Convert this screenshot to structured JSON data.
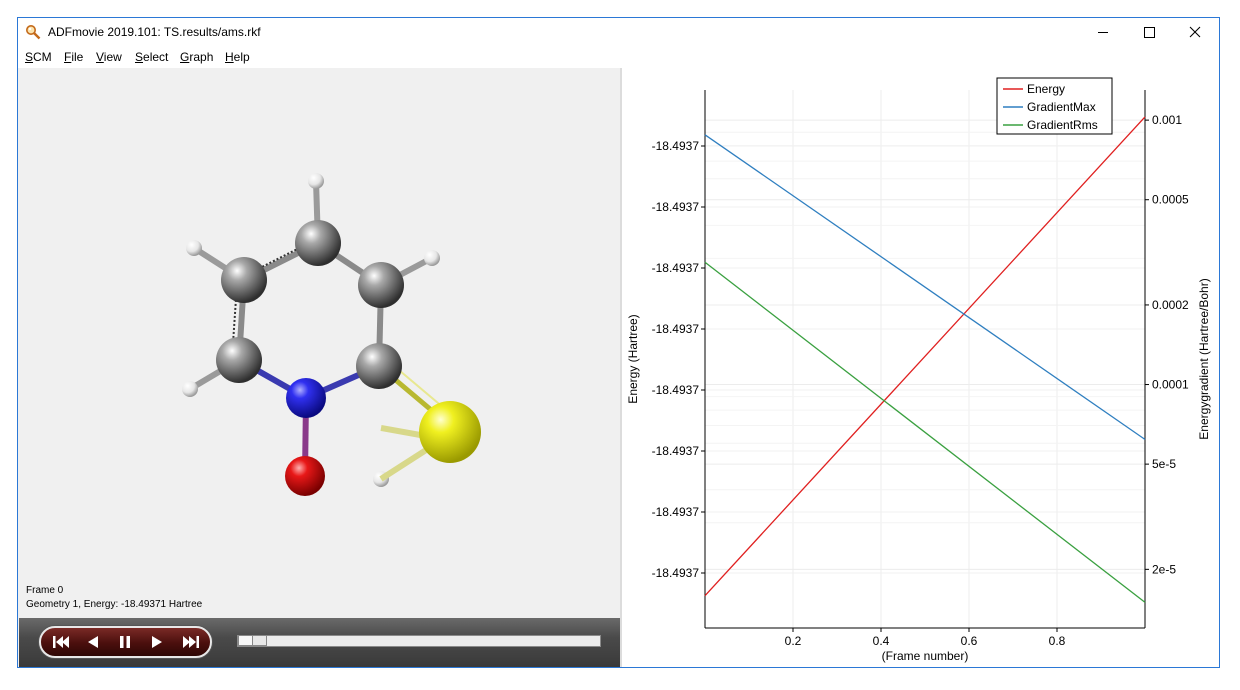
{
  "window": {
    "title": "ADFmovie 2019.101: TS.results/ams.rkf",
    "icons": {
      "app": "magnifier-app-icon",
      "minimize": "minimize-icon",
      "maximize": "maximize-icon",
      "close": "close-icon"
    }
  },
  "menu": [
    {
      "label": "SCM",
      "accel": "S",
      "rest": "CM"
    },
    {
      "label": "File",
      "accel": "F",
      "rest": "ile"
    },
    {
      "label": "View",
      "accel": "V",
      "rest": "iew"
    },
    {
      "label": "Select",
      "accel": "S",
      "rest": "elect"
    },
    {
      "label": "Graph",
      "accel": "G",
      "rest": "raph"
    },
    {
      "label": "Help",
      "accel": "H",
      "rest": "elp"
    }
  ],
  "viewer": {
    "frame_label": "Frame 0",
    "geometry_label": "Geometry 1, Energy: -18.49371 Hartree",
    "atom_colors": {
      "C": "#5a5a5a",
      "H": "#f4f4f4",
      "N": "#1a1ae0",
      "O": "#e01010",
      "S": "#e8e800"
    }
  },
  "player": {
    "buttons": [
      "skip-to-start-icon",
      "play-backward-icon",
      "pause-icon",
      "play-forward-icon",
      "skip-to-end-icon"
    ],
    "slider_value": 0
  },
  "chart_data": {
    "type": "line",
    "xlabel": "(Frame number)",
    "ylabel_left": "Energy (Hartree)",
    "ylabel_right": "Energygradient (Hartree/Bohr)",
    "x_ticks": [
      "0.2",
      "0.4",
      "0.6",
      "0.8"
    ],
    "x_tick_values": [
      0.2,
      0.4,
      0.6,
      0.8
    ],
    "xlim": [
      0,
      1
    ],
    "left_ticks": [
      "-18.4937",
      "-18.4937",
      "-18.4937",
      "-18.4937",
      "-18.4937",
      "-18.4937",
      "-18.4937",
      "-18.4937"
    ],
    "right_ticks": [
      "0.001",
      "0.0005",
      "0.0002",
      "0.0001",
      "5e-5",
      "2e-5"
    ],
    "right_tick_values": [
      0.001,
      0.0005,
      0.0002,
      0.0001,
      5e-05,
      2e-05
    ],
    "right_scale": "log",
    "right_ylim": [
      1.2e-05,
      0.0013
    ],
    "grid": true,
    "legend_position": "top-right",
    "series": [
      {
        "name": "Energy",
        "color": "#e02020",
        "axis": "left",
        "x": [
          0,
          1
        ],
        "y_frac": [
          0.06,
          0.95
        ]
      },
      {
        "name": "GradientMax",
        "color": "#2f7fc0",
        "axis": "right",
        "x": [
          0,
          1
        ],
        "y": [
          0.00088,
          6.2e-05
        ]
      },
      {
        "name": "GradientRms",
        "color": "#3aa040",
        "axis": "right",
        "x": [
          0,
          1
        ],
        "y": [
          0.00029,
          1.5e-05
        ]
      }
    ]
  }
}
